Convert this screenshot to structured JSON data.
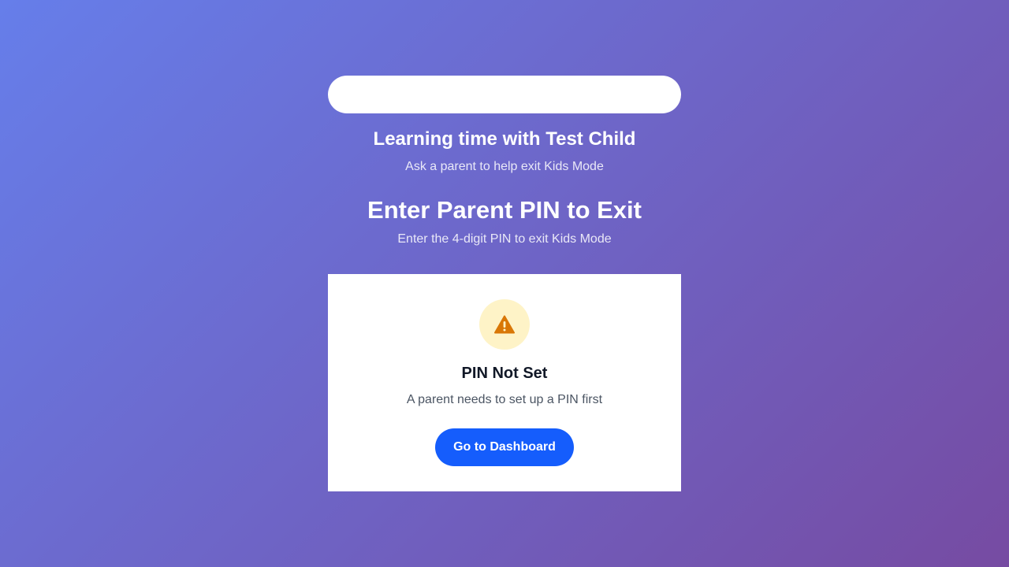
{
  "header": {
    "learning_title": "Learning time with Test Child",
    "learning_subtitle": "Ask a parent to help exit Kids Mode",
    "pin_title": "Enter Parent PIN to Exit",
    "pin_subtitle": "Enter the 4-digit PIN to exit Kids Mode"
  },
  "card": {
    "icon": "warning-icon",
    "title": "PIN Not Set",
    "message": "A parent needs to set up a PIN first",
    "button_label": "Go to Dashboard"
  },
  "colors": {
    "gradient_start": "#667eea",
    "gradient_end": "#764ba2",
    "button": "#155dfc",
    "warning_bg": "#fef3c7",
    "warning_icon": "#d97706"
  }
}
